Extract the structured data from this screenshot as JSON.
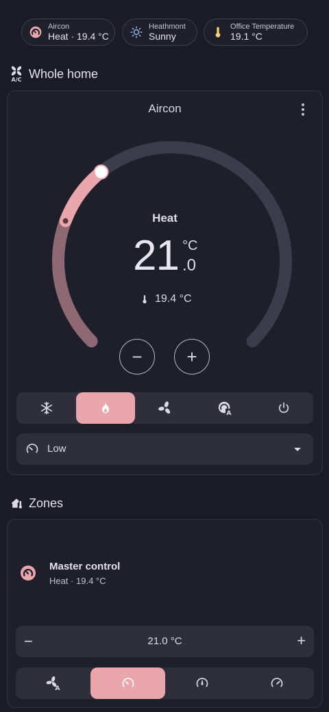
{
  "colors": {
    "background": "#1b1b26",
    "card": "#1f1f2a",
    "accent_heat": "#eaa6ad",
    "track": "#3c3c4a",
    "sun_icon": "#8fb6f2",
    "thermometer_icon": "#f2d27a"
  },
  "header_chips": [
    {
      "icon": "aircon-heat-icon",
      "line1": "Aircon",
      "line2": "Heat · 19.4 °C"
    },
    {
      "icon": "sun-icon",
      "line1": "Heathmont",
      "line2": "Sunny"
    },
    {
      "icon": "thermometer-icon",
      "line1": "Office Temperature",
      "line2": "19.1 °C"
    }
  ],
  "whole_home": {
    "section_label": "Whole home",
    "section_icon": "air-conditioner-icon",
    "card": {
      "title": "Aircon",
      "mode": "Heat",
      "target_int": "21",
      "unit": "°C",
      "target_dec": ".0",
      "current_temp": "19.4 °C",
      "target_temp": 21.0,
      "current_temp_value": 19.4,
      "minus_label": "−",
      "plus_label": "+",
      "hvac_modes": [
        {
          "name": "cool",
          "icon": "snowflake-icon",
          "active": false
        },
        {
          "name": "heat",
          "icon": "fire-icon",
          "active": true
        },
        {
          "name": "fan_only",
          "icon": "fan-icon",
          "active": false
        },
        {
          "name": "auto",
          "icon": "thermostat-auto-icon",
          "active": false
        },
        {
          "name": "off",
          "icon": "power-icon",
          "active": false
        }
      ],
      "fan_mode": {
        "icon": "fan-speed-icon",
        "value": "Low"
      }
    }
  },
  "zones": {
    "section_label": "Zones",
    "section_icon": "home-thermometer-icon",
    "master": {
      "name": "Master control",
      "status": "Heat · 19.4 °C",
      "icon": "aircon-heat-icon",
      "setpoint": "21.0 °C",
      "minus_label": "−",
      "plus_label": "+",
      "modes": [
        {
          "icon": "fan-auto-icon",
          "active": false
        },
        {
          "icon": "speedometer-low-icon",
          "active": true
        },
        {
          "icon": "gauge-mid-icon",
          "active": false
        },
        {
          "icon": "speedometer-high-icon",
          "active": false
        }
      ]
    }
  }
}
